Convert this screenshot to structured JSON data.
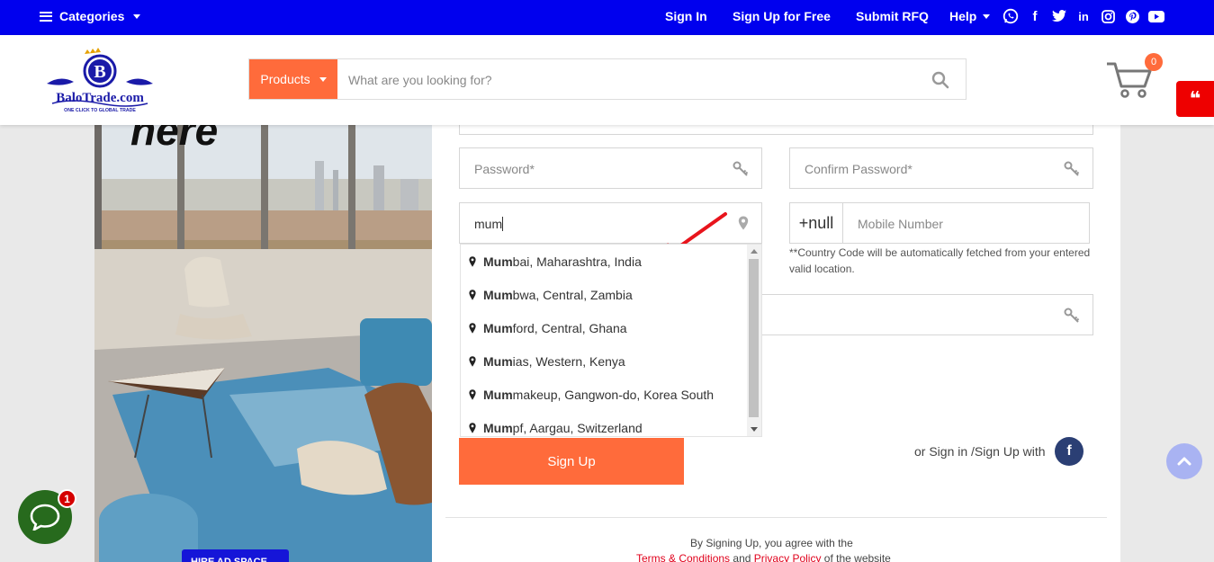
{
  "topbar": {
    "categories": "Categories",
    "sign_in": "Sign In",
    "sign_up_free": "Sign Up for Free",
    "submit_rfq": "Submit RFQ",
    "help": "Help"
  },
  "header": {
    "logo_text": "BaloTrade.com",
    "logo_tagline": "ONE CLICK TO GLOBAL TRADE",
    "search_category": "Products",
    "search_placeholder": "What are you looking for?",
    "cart_count": "0"
  },
  "hero": {
    "headline_fragment": "here",
    "ad_label": "HIRE AD SPACE"
  },
  "form": {
    "password_placeholder": "Password*",
    "confirm_password_placeholder": "Confirm Password*",
    "location_value": "mum",
    "country_code": "+null",
    "mobile_placeholder": "Mobile Number",
    "country_code_note": "**Country Code will be automatically fetched from your entered valid location.",
    "signup_button": "Sign Up",
    "social_text": "or Sign in /Sign Up with",
    "terms_line1": "By Signing Up, you agree with the",
    "terms_link": "Terms & Conditions",
    "terms_and": "and",
    "privacy_link": "Privacy Policy",
    "terms_tail": "of the website"
  },
  "suggestions": [
    {
      "match": "Mum",
      "rest": "bai, Maharashtra, India"
    },
    {
      "match": "Mum",
      "rest": "bwa, Central, Zambia"
    },
    {
      "match": "Mum",
      "rest": "ford, Central, Ghana"
    },
    {
      "match": "Mum",
      "rest": "ias, Western, Kenya"
    },
    {
      "match": "Mum",
      "rest": "makeup, Gangwon-do, Korea South"
    },
    {
      "match": "Mum",
      "rest": "pf, Aargau, Switzerland"
    }
  ],
  "chat": {
    "badge": "1"
  },
  "colors": {
    "topbar": "#0000ee",
    "accent": "#ff6b3b",
    "quote_tab": "#ee0000",
    "facebook": "#2b3f74",
    "chat": "#276a1d"
  },
  "icons": [
    "menu-icon",
    "whatsapp-icon",
    "facebook-icon",
    "twitter-icon",
    "linkedin-icon",
    "instagram-icon",
    "pinterest-icon",
    "youtube-icon",
    "search-icon",
    "cart-icon",
    "quote-icon",
    "key-icon",
    "map-pin-icon",
    "arrow-up-icon",
    "chat-icon"
  ]
}
